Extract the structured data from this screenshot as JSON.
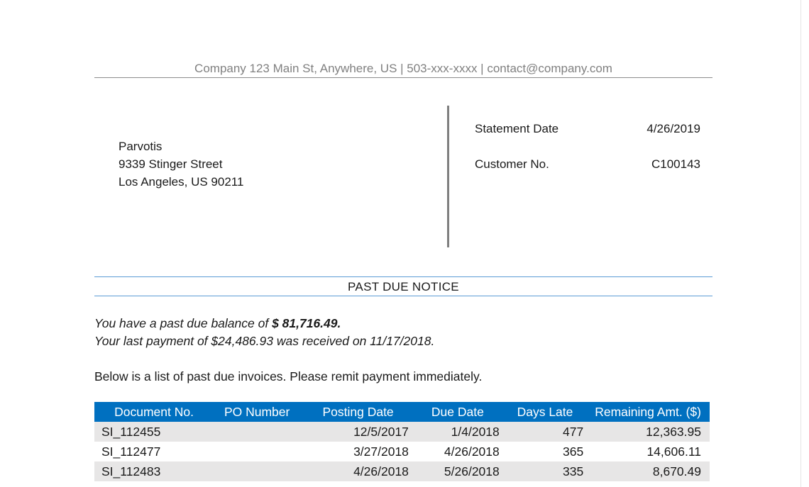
{
  "letterhead": "Company 123 Main St, Anywhere, US | 503-xxx-xxxx | contact@company.com",
  "customer": {
    "name": "Parvotis",
    "street": "9339 Stinger Street",
    "city_line": "Los Angeles, US 90211"
  },
  "statement": {
    "date_label": "Statement Date",
    "date_value": "4/26/2019",
    "customer_no_label": "Customer No.",
    "customer_no_value": "C100143"
  },
  "notice_title": "PAST DUE NOTICE",
  "balance": {
    "line1_prefix": "You have a past due balance of ",
    "amount": "$ 81,716.49.",
    "line2": "Your last payment of $24,486.93 was received on 11/17/2018."
  },
  "instruction": "Below is a list of past due invoices. Please remit payment immediately.",
  "table": {
    "headers": [
      "Document No.",
      "PO Number",
      "Posting Date",
      "Due Date",
      "Days Late",
      "Remaining Amt. ($)"
    ],
    "rows": [
      [
        "SI_112455",
        "",
        "12/5/2017",
        "1/4/2018",
        "477",
        "12,363.95"
      ],
      [
        "SI_112477",
        "",
        "3/27/2018",
        "4/26/2018",
        "365",
        "14,606.11"
      ],
      [
        "SI_112483",
        "",
        "4/26/2018",
        "5/26/2018",
        "335",
        "8,670.49"
      ]
    ]
  },
  "colors": {
    "header_fill": "#0070c0",
    "row_shade": "#e7e6e6",
    "notice_rule": "#5b9bd5",
    "letterhead_text": "#808080"
  }
}
